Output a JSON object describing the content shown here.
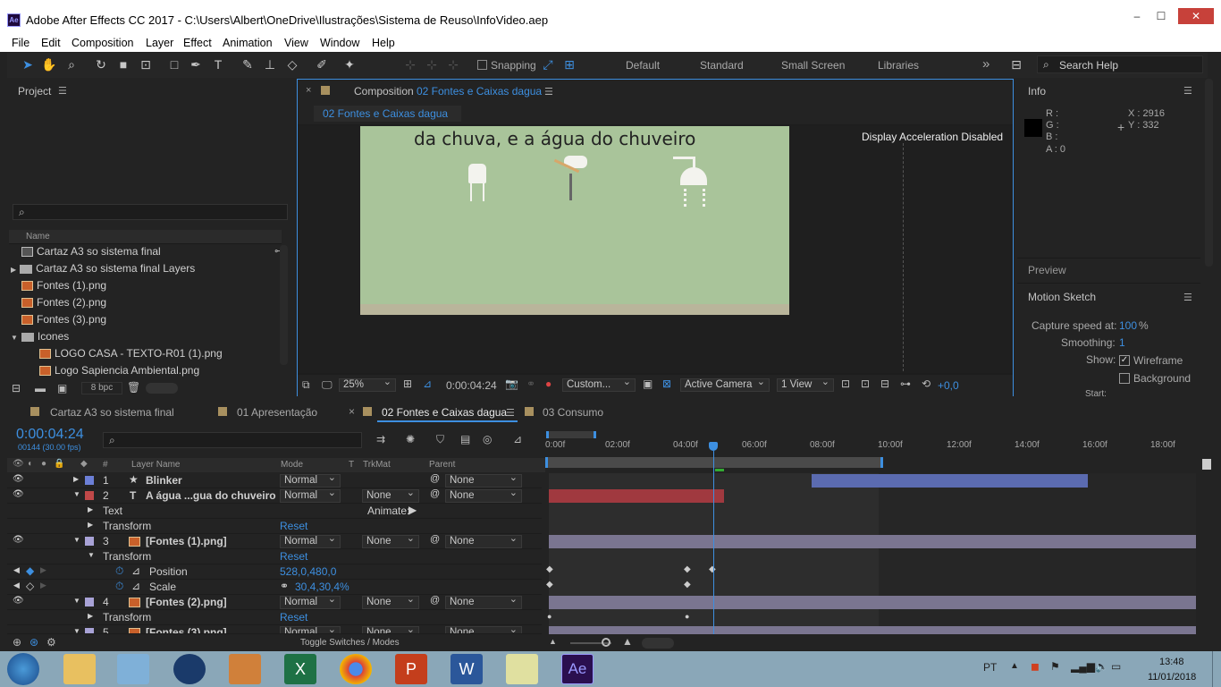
{
  "window": {
    "title": "Adobe After Effects CC 2017 - C:\\Users\\Albert\\OneDrive\\Ilustrações\\Sistema de Reuso\\InfoVideo.aep",
    "app_icon": "Ae",
    "minimize": "‒",
    "maximize": "☐",
    "close": "✕"
  },
  "menu": [
    "File",
    "Edit",
    "Composition",
    "Layer",
    "Effect",
    "Animation",
    "View",
    "Window",
    "Help"
  ],
  "toolbar": {
    "snapping": "Snapping",
    "workspaces": [
      "Default",
      "Standard",
      "Small Screen",
      "Libraries"
    ],
    "more": "»",
    "search_placeholder": "Search Help"
  },
  "project": {
    "title": "Project",
    "search_placeholder": "",
    "col_name": "Name",
    "items": [
      {
        "name": "Cartaz A3 so sistema final",
        "type": "comp",
        "indent": 0,
        "twisty": ""
      },
      {
        "name": "Cartaz A3 so sistema final Layers",
        "type": "folder",
        "indent": 0,
        "twisty": "▶"
      },
      {
        "name": "Fontes (1).png",
        "type": "file",
        "indent": 0,
        "twisty": ""
      },
      {
        "name": "Fontes (2).png",
        "type": "file",
        "indent": 0,
        "twisty": ""
      },
      {
        "name": "Fontes (3).png",
        "type": "file",
        "indent": 0,
        "twisty": ""
      },
      {
        "name": "Icones",
        "type": "folder",
        "indent": 0,
        "twisty": "▼"
      },
      {
        "name": "LOGO CASA - TEXTO-R01 (1).png",
        "type": "file",
        "indent": 1,
        "twisty": ""
      },
      {
        "name": "Logo Sapiencia Ambiental.png",
        "type": "file",
        "indent": 1,
        "twisty": ""
      }
    ],
    "bpc": "8 bpc"
  },
  "composition": {
    "tab_prefix": "Composition",
    "tab_name": "02 Fontes e Caixas dagua",
    "breadcrumb": "02 Fontes e Caixas dagua",
    "canvas_text": "da chuva, e a água do chuveiro",
    "accel": "Display Acceleration Disabled",
    "zoom": "25%",
    "timecode": "0:00:04:24",
    "resolution": "Custom...",
    "camera": "Active Camera",
    "views": "1 View",
    "exposure": "+0,0"
  },
  "info": {
    "title": "Info",
    "r": "R :",
    "g": "G :",
    "b": "B :",
    "a": "A : 0",
    "x": "X : 2916",
    "y": "Y : 332",
    "preview": "Preview"
  },
  "motion_sketch": {
    "title": "Motion Sketch",
    "capture_label": "Capture speed at:",
    "capture_value": "100",
    "capture_unit": "%",
    "smoothing_label": "Smoothing:",
    "smoothing_value": "1",
    "show_label": "Show:",
    "wireframe": "Wireframe",
    "background": "Background",
    "start": "Start:"
  },
  "timeline": {
    "tabs": [
      "Cartaz A3 so sistema final",
      "01 Apresentação",
      "02 Fontes e Caixas dagua",
      "03 Consumo"
    ],
    "timecode": "0:00:04:24",
    "frames": "00144 (30.00 fps)",
    "ruler": [
      "0:00f",
      "02:00f",
      "04:00f",
      "06:00f",
      "08:00f",
      "10:00f",
      "12:00f",
      "14:00f",
      "16:00f",
      "18:00f"
    ],
    "cols": {
      "hash": "#",
      "layer_name": "Layer Name",
      "mode": "Mode",
      "t": "T",
      "trkmat": "TrkMat",
      "parent": "Parent"
    },
    "rows": [
      {
        "num": "1",
        "name": "Blinker",
        "mode": "Normal",
        "trkmat": "",
        "parent": "None"
      },
      {
        "num": "2",
        "name": "A água ...gua do chuveiro",
        "mode": "Normal",
        "trkmat": "None",
        "parent": "None"
      },
      {
        "text": "Text",
        "animate": "Animate:"
      },
      {
        "transform": "Transform",
        "reset": "Reset"
      },
      {
        "num": "3",
        "name": "[Fontes (1).png]",
        "mode": "Normal",
        "trkmat": "None",
        "parent": "None"
      },
      {
        "transform": "Transform",
        "reset": "Reset"
      },
      {
        "prop": "Position",
        "value": "528,0,480,0"
      },
      {
        "prop": "Scale",
        "value": "30,4,30,4%"
      },
      {
        "num": "4",
        "name": "[Fontes (2).png]",
        "mode": "Normal",
        "trkmat": "None",
        "parent": "None"
      },
      {
        "transform": "Transform",
        "reset": "Reset"
      },
      {
        "num": "5",
        "name": "[Fontes (3).png]",
        "mode": "Normal",
        "trkmat": "None",
        "parent": "None"
      }
    ],
    "toggle": "Toggle Switches / Modes"
  },
  "taskbar": {
    "lang": "PT",
    "time": "13:48",
    "date": "11/01/2018"
  },
  "colors": {
    "accent": "#3d8fe0",
    "label_blue": "#6c7fd6",
    "label_red": "#c04848",
    "label_lavender": "#a8a2d6",
    "comp_bg": "#a9c49a"
  }
}
